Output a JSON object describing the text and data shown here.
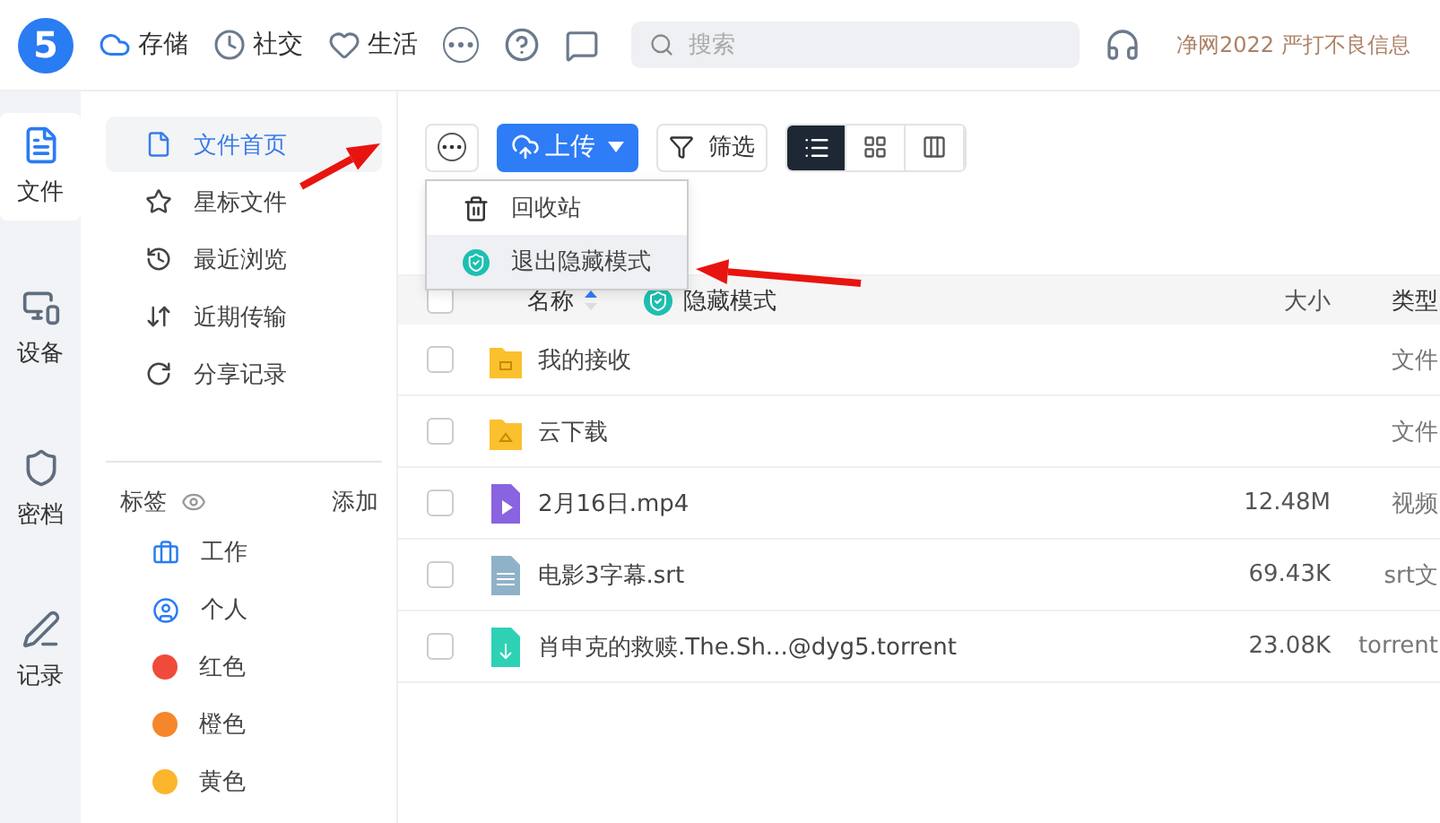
{
  "logo": "5",
  "top_nav": [
    {
      "label": "存储",
      "kind": "cloud"
    },
    {
      "label": "社交",
      "kind": "clock"
    },
    {
      "label": "生活",
      "kind": "heart"
    }
  ],
  "search": {
    "placeholder": "搜索"
  },
  "notice": "净网2022 严打不良信息",
  "rail": [
    {
      "label": "文件",
      "kind": "files",
      "selected": true
    },
    {
      "label": "设备",
      "kind": "devices",
      "selected": false
    },
    {
      "label": "密档",
      "kind": "shield",
      "selected": false
    },
    {
      "label": "记录",
      "kind": "pen",
      "selected": false
    }
  ],
  "sidebar": {
    "items": [
      {
        "label": "文件首页",
        "kind": "file",
        "selected": true
      },
      {
        "label": "星标文件",
        "kind": "star",
        "selected": false
      },
      {
        "label": "最近浏览",
        "kind": "history",
        "selected": false
      },
      {
        "label": "近期传输",
        "kind": "transfer",
        "selected": false
      },
      {
        "label": "分享记录",
        "kind": "share",
        "selected": false
      }
    ],
    "tags_title": "标签",
    "tags_action": "添加",
    "tags": [
      {
        "label": "工作",
        "kind": "briefcase"
      },
      {
        "label": "个人",
        "kind": "user"
      },
      {
        "label": "红色",
        "kind": "dot",
        "color": "#f04b3a"
      },
      {
        "label": "橙色",
        "kind": "dot",
        "color": "#f5862a"
      },
      {
        "label": "黄色",
        "kind": "dot",
        "color": "#fbb52c"
      }
    ]
  },
  "toolbar": {
    "upload": "上传",
    "filter": "筛选",
    "views": [
      {
        "kind": "list",
        "selected": true
      },
      {
        "kind": "grid",
        "selected": false
      },
      {
        "kind": "columns",
        "selected": false
      }
    ]
  },
  "menu": [
    {
      "label": "回收站",
      "kind": "trash",
      "selected": false
    },
    {
      "label": "退出隐藏模式",
      "kind": "hidden",
      "selected": true
    }
  ],
  "table": {
    "all_checked": false,
    "columns": {
      "name": "名称",
      "hidden_mode": "隐藏模式",
      "size": "大小",
      "type": "类型"
    },
    "rows": [
      {
        "name": "我的接收",
        "kind": "folder-inbox",
        "type": "文件",
        "checked": false
      },
      {
        "name": "云下载",
        "kind": "folder-cloud",
        "type": "文件",
        "checked": false
      },
      {
        "name": "2月16日.mp4",
        "kind": "video",
        "size": "12.48M",
        "type": "视频",
        "checked": false
      },
      {
        "name": "电影3字幕.srt",
        "kind": "text",
        "size": "69.43K",
        "type": "srt文",
        "checked": false
      },
      {
        "name": "肖申克的救赎.The.Sh...@dyg5.torrent",
        "kind": "torrent",
        "size": "23.08K",
        "type": "torrent",
        "checked": false
      }
    ]
  }
}
